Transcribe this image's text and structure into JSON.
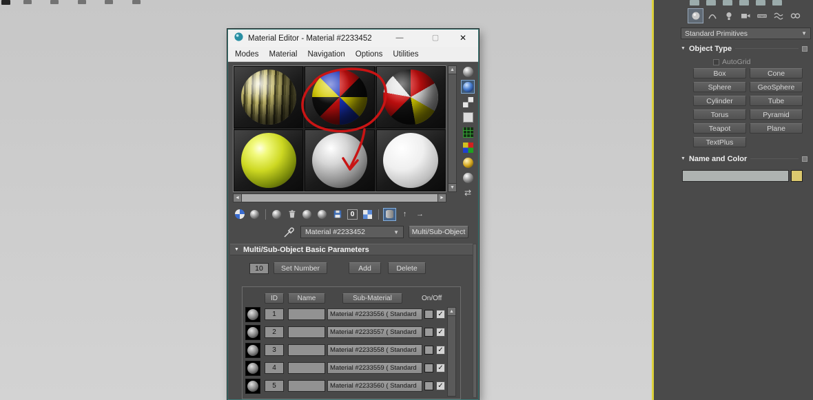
{
  "material_editor": {
    "title": "Material Editor - Material #2233452",
    "minimize_glyph": "—",
    "maximize_glyph": "▢",
    "close_glyph": "✕",
    "menu": [
      "Modes",
      "Material",
      "Navigation",
      "Options",
      "Utilities"
    ],
    "samples": [
      "striped-yellow-texture-sphere",
      "multicolor-checker-sphere",
      "multicolor-checker-sphere-2",
      "glossy-yellow-sphere",
      "gray-sphere",
      "white-sphere"
    ],
    "sample_toolbar_icons": [
      "sample-type-sphere",
      "backlight",
      "background-checker",
      "sample-tiling",
      "video-color-check",
      "make-preview",
      "options",
      "select-by-material",
      "material-map-navigator"
    ],
    "toolbar_icons": [
      "get-material",
      "put-material-to-scene",
      "assign-material-to-selection",
      "reset-map",
      "make-material-copy",
      "make-unique",
      "put-to-library",
      "material-id-channel",
      "show-shaded-in-viewport",
      "show-end-result",
      "go-to-parent",
      "go-forward-to-sibling"
    ],
    "material_id_value": "0",
    "material_name_dropdown": "Material #2233452",
    "type_button_label": "Multi/Sub-Object",
    "rollout_title": "Multi/Sub-Object Basic Parameters",
    "params": {
      "count_value": "10",
      "set_number_label": "Set Number",
      "add_label": "Add",
      "delete_label": "Delete"
    },
    "grid": {
      "id_header": "ID",
      "name_header": "Name",
      "sub_material_header": "Sub-Material",
      "onoff_header": "On/Off",
      "rows": [
        {
          "id": "1",
          "name": "",
          "sub_material": "Material #2233556 ( Standard",
          "on": true
        },
        {
          "id": "2",
          "name": "",
          "sub_material": "Material #2233557 ( Standard",
          "on": true
        },
        {
          "id": "3",
          "name": "",
          "sub_material": "Material #2233558 ( Standard",
          "on": true
        },
        {
          "id": "4",
          "name": "",
          "sub_material": "Material #2233559 ( Standard",
          "on": true
        },
        {
          "id": "5",
          "name": "",
          "sub_material": "Material #2233560 ( Standard",
          "on": true
        }
      ]
    }
  },
  "command_panel": {
    "category_icons": [
      "geometry",
      "shapes",
      "lights",
      "cameras",
      "helpers",
      "space-warps",
      "systems"
    ],
    "primitives_dropdown": "Standard Primitives",
    "object_type": {
      "title": "Object Type",
      "autogrid_label": "AutoGrid",
      "buttons": [
        "Box",
        "Cone",
        "Sphere",
        "GeoSphere",
        "Cylinder",
        "Tube",
        "Torus",
        "Pyramid",
        "Teapot",
        "Plane",
        "TextPlus"
      ]
    },
    "name_and_color": {
      "title": "Name and Color",
      "name_value": "",
      "swatch_color": "#dcc96e"
    }
  },
  "annotation": {
    "color": "#c91414",
    "description": "hand-drawn red circle around second material sample and arrow pointing down to gray sample"
  },
  "colors": {
    "window_border_teal": "#3d7c78",
    "viewport_active_border_yellow": "#ddd23e"
  }
}
